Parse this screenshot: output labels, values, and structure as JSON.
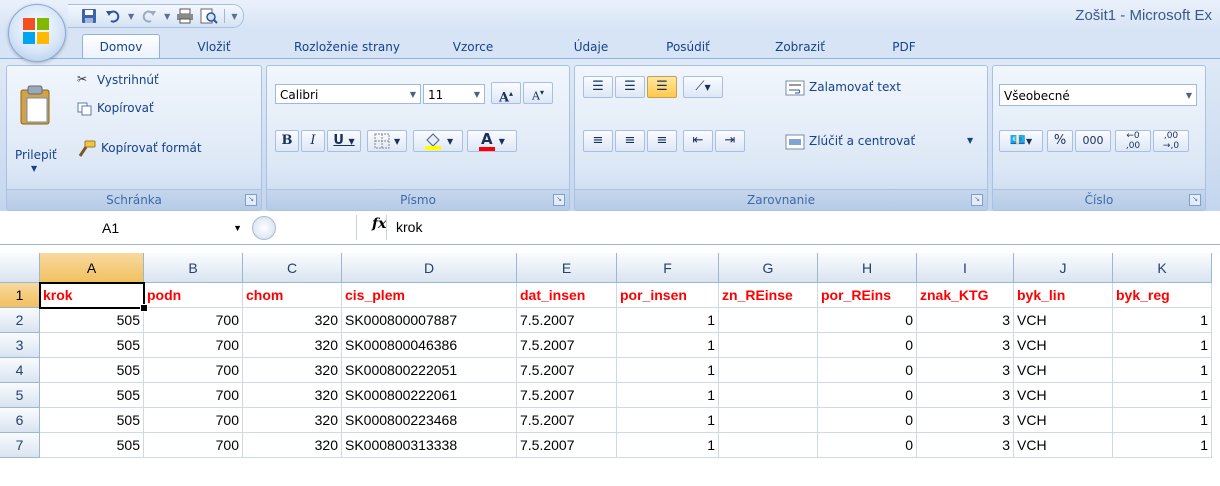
{
  "window": {
    "title": "Zošit1 - Microsoft Ex",
    "quick_access": [
      "save-icon",
      "undo-icon",
      "redo-icon",
      "quick-print-icon",
      "print-preview-icon",
      "customize-dropdown-icon"
    ]
  },
  "tabs": [
    {
      "label": "Domov",
      "active": true
    },
    {
      "label": "Vložiť",
      "active": false
    },
    {
      "label": "Rozloženie strany",
      "active": false
    },
    {
      "label": "Vzorce",
      "active": false
    },
    {
      "label": "Údaje",
      "active": false
    },
    {
      "label": "Posúdiť",
      "active": false
    },
    {
      "label": "Zobraziť",
      "active": false
    },
    {
      "label": "PDF",
      "active": false
    }
  ],
  "ribbon": {
    "clipboard": {
      "title": "Schránka",
      "paste": "Prilepiť",
      "cut": "Vystrihnúť",
      "copy": "Kopírovať",
      "format_painter": "Kopírovať formát"
    },
    "font": {
      "title": "Písmo",
      "name": "Calibri",
      "size": "11",
      "bold": "B",
      "italic": "I",
      "underline": "U",
      "grow": "A",
      "shrink": "A",
      "font_color_accent": "#ff0000",
      "fill_color_accent": "#ffff00"
    },
    "alignment": {
      "title": "Zarovnanie",
      "wrap_text": "Zalamovať text",
      "merge_center": "Zlúčiť a centrovať"
    },
    "number": {
      "title": "Číslo",
      "format": "Všeobecné",
      "percent": "%",
      "thousands": "000"
    }
  },
  "formula_bar": {
    "name_box": "A1",
    "fx_label": "fx",
    "content": "krok"
  },
  "sheet": {
    "columns": [
      "A",
      "B",
      "C",
      "D",
      "E",
      "F",
      "G",
      "H",
      "I",
      "J",
      "K"
    ],
    "selected_column": "A",
    "selected_row": "1",
    "rows": [
      {
        "n": "1",
        "cells": [
          "krok",
          "podn",
          "chom",
          "cis_plem",
          "dat_insen",
          "por_insen",
          "zn_REinse",
          "por_REins",
          "znak_KTG",
          "byk_lin",
          "byk_reg"
        ]
      },
      {
        "n": "2",
        "cells": [
          "505",
          "700",
          "320",
          "SK000800007887",
          "7.5.2007",
          "1",
          "",
          "0",
          "3",
          "VCH",
          "1"
        ]
      },
      {
        "n": "3",
        "cells": [
          "505",
          "700",
          "320",
          "SK000800046386",
          "7.5.2007",
          "1",
          "",
          "0",
          "3",
          "VCH",
          "1"
        ]
      },
      {
        "n": "4",
        "cells": [
          "505",
          "700",
          "320",
          "SK000800222051",
          "7.5.2007",
          "1",
          "",
          "0",
          "3",
          "VCH",
          "1"
        ]
      },
      {
        "n": "5",
        "cells": [
          "505",
          "700",
          "320",
          "SK000800222061",
          "7.5.2007",
          "1",
          "",
          "0",
          "3",
          "VCH",
          "1"
        ]
      },
      {
        "n": "6",
        "cells": [
          "505",
          "700",
          "320",
          "SK000800223468",
          "7.5.2007",
          "1",
          "",
          "0",
          "3",
          "VCH",
          "1"
        ]
      },
      {
        "n": "7",
        "cells": [
          "505",
          "700",
          "320",
          "SK000800313338",
          "7.5.2007",
          "1",
          "",
          "0",
          "3",
          "VCH",
          "1"
        ]
      }
    ],
    "header_text_color": "#ff0000"
  }
}
